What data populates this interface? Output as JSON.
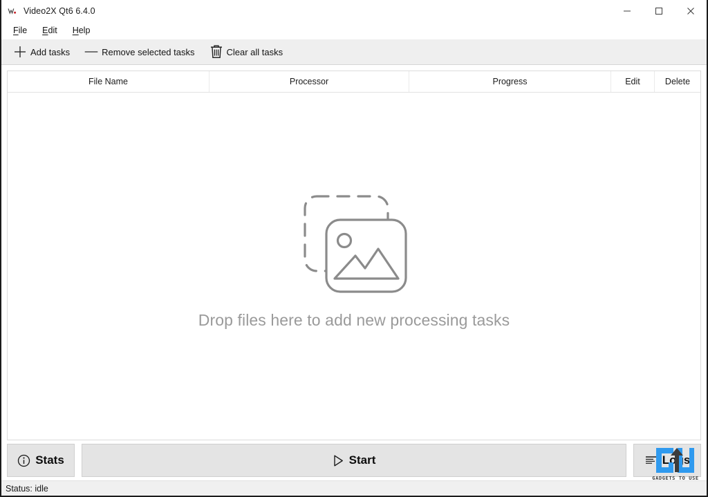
{
  "window": {
    "title": "Video2X Qt6 6.4.0",
    "icon": "video2x-app-icon",
    "controls": {
      "minimize": "minimize-icon",
      "maximize": "maximize-icon",
      "close": "close-icon"
    }
  },
  "menubar": {
    "items": [
      {
        "label": "File",
        "mnemonic": "F",
        "rest": "ile"
      },
      {
        "label": "Edit",
        "mnemonic": "E",
        "rest": "dit"
      },
      {
        "label": "Help",
        "mnemonic": "H",
        "rest": "elp"
      }
    ]
  },
  "toolbar": {
    "add_tasks": "Add tasks",
    "remove_selected_tasks": "Remove selected tasks",
    "clear_all_tasks": "Clear all tasks",
    "icons": {
      "add": "plus-icon",
      "remove": "minus-icon",
      "clear": "trash-icon"
    }
  },
  "task_table": {
    "columns": [
      {
        "id": "file-name",
        "label": "File Name"
      },
      {
        "id": "processor",
        "label": "Processor"
      },
      {
        "id": "progress",
        "label": "Progress"
      },
      {
        "id": "edit",
        "label": "Edit"
      },
      {
        "id": "delete",
        "label": "Delete"
      }
    ],
    "rows": [],
    "empty_state": {
      "icon": "image-stack-icon",
      "message": "Drop files here to add new processing tasks"
    }
  },
  "actions": {
    "stats": {
      "label": "Stats",
      "icon": "info-circle-icon"
    },
    "start": {
      "label": "Start",
      "icon": "play-triangle-icon"
    },
    "logs": {
      "label": "Logs",
      "icon": "list-lines-icon"
    }
  },
  "statusbar": {
    "text": "Status: idle"
  },
  "watermark": {
    "text": "GADGETS TO USE",
    "accent_color": "#2f9aef"
  },
  "colors": {
    "toolbar_bg": "#efefef",
    "panel_bg": "#ffffff",
    "button_bg": "#e4e4e4",
    "placeholder_text": "#9a9a9a",
    "border": "#dcdcdc"
  }
}
